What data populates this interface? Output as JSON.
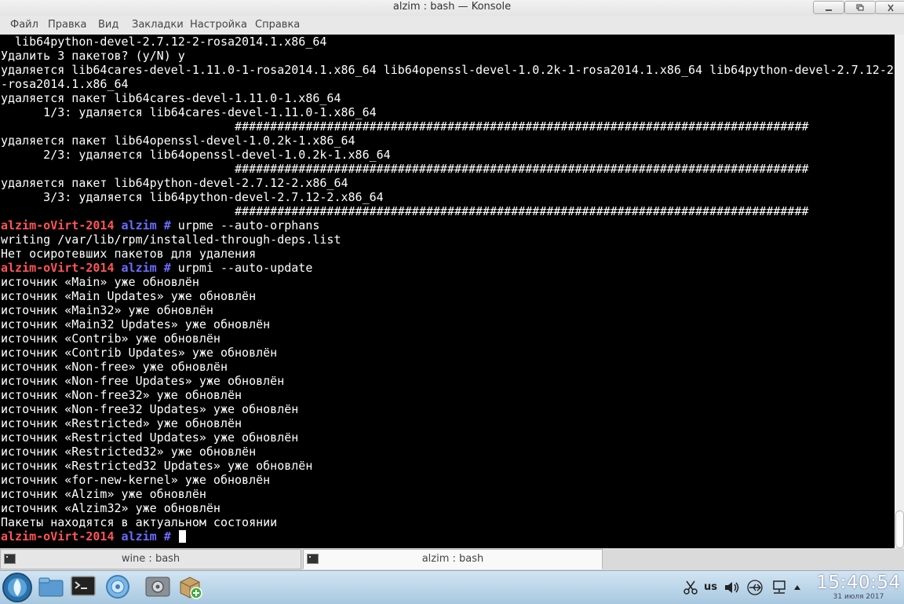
{
  "window": {
    "title": "alzim : bash — Konsole",
    "buttons": [
      "minimize-icon",
      "maximize-icon",
      "close-icon"
    ]
  },
  "menu": [
    "Файл",
    "Правка",
    "Вид",
    "Закладки",
    "Настройка",
    "Справка"
  ],
  "colors": {
    "terminal_bg": "#000000",
    "terminal_fg": "#ffffff",
    "prompt_host": "#ff5555",
    "prompt_user": "#6c6cff"
  },
  "prompt": {
    "host": "alzim-oVirt-2014",
    "user": "alzim",
    "hash": "#"
  },
  "terminal": [
    {
      "text": "  lib64python-devel-2.7.12-2-rosa2014.1.x86_64"
    },
    {
      "text": "Удалить 3 пакетов? (y/N) y"
    },
    {
      "text": "удаляется lib64cares-devel-1.11.0-1-rosa2014.1.x86_64 lib64openssl-devel-1.0.2k-1-rosa2014.1.x86_64 lib64python-devel-2.7.12-2"
    },
    {
      "text": "-rosa2014.1.x86_64"
    },
    {
      "text": "удаляется пакет lib64cares-devel-1.11.0-1.x86_64"
    },
    {
      "text": "      1/3: удаляется lib64cares-devel-1.11.0-1.x86_64"
    },
    {
      "text": "                                 #################################################################################"
    },
    {
      "text": "удаляется пакет lib64openssl-devel-1.0.2k-1.x86_64"
    },
    {
      "text": "      2/3: удаляется lib64openssl-devel-1.0.2k-1.x86_64"
    },
    {
      "text": "                                 #################################################################################"
    },
    {
      "text": "удаляется пакет lib64python-devel-2.7.12-2.x86_64"
    },
    {
      "text": "      3/3: удаляется lib64python-devel-2.7.12-2.x86_64"
    },
    {
      "text": "                                 #################################################################################"
    },
    {
      "prompt": true,
      "cmd": " urpme --auto-orphans"
    },
    {
      "text": "writing /var/lib/rpm/installed-through-deps.list"
    },
    {
      "text": "Нет осиротевших пакетов для удаления"
    },
    {
      "prompt": true,
      "cmd": " urpmi --auto-update"
    },
    {
      "text": "источник «Main» уже обновлён"
    },
    {
      "text": "источник «Main Updates» уже обновлён"
    },
    {
      "text": "источник «Main32» уже обновлён"
    },
    {
      "text": "источник «Main32 Updates» уже обновлён"
    },
    {
      "text": "источник «Contrib» уже обновлён"
    },
    {
      "text": "источник «Contrib Updates» уже обновлён"
    },
    {
      "text": "источник «Non-free» уже обновлён"
    },
    {
      "text": "источник «Non-free Updates» уже обновлён"
    },
    {
      "text": "источник «Non-free32» уже обновлён"
    },
    {
      "text": "источник «Non-free32 Updates» уже обновлён"
    },
    {
      "text": "источник «Restricted» уже обновлён"
    },
    {
      "text": "источник «Restricted Updates» уже обновлён"
    },
    {
      "text": "источник «Restricted32» уже обновлён"
    },
    {
      "text": "источник «Restricted32 Updates» уже обновлён"
    },
    {
      "text": "источник «for-new-kernel» уже обновлён"
    },
    {
      "text": "источник «Alzim» уже обновлён"
    },
    {
      "text": "источник «Alzim32» уже обновлён"
    },
    {
      "text": "Пакеты находятся в актуальном состоянии"
    },
    {
      "prompt": true,
      "cmd": " ",
      "cursor": true
    }
  ],
  "tabs": [
    {
      "label": "wine : bash",
      "active": false
    },
    {
      "label": "alzim : bash",
      "active": true
    }
  ],
  "taskbar": {
    "launchers": [
      "start-menu-icon",
      "file-manager-icon",
      "terminal-icon",
      "browser-icon",
      "settings-icon",
      "package-installer-icon"
    ],
    "tray": {
      "layout": "us",
      "icons": [
        "scissors-icon",
        "volume-icon",
        "usb-icon",
        "network-icon",
        "tray-expand-icon"
      ]
    },
    "clock": {
      "time": "15:40:54",
      "date": "31 июля 2017"
    }
  }
}
